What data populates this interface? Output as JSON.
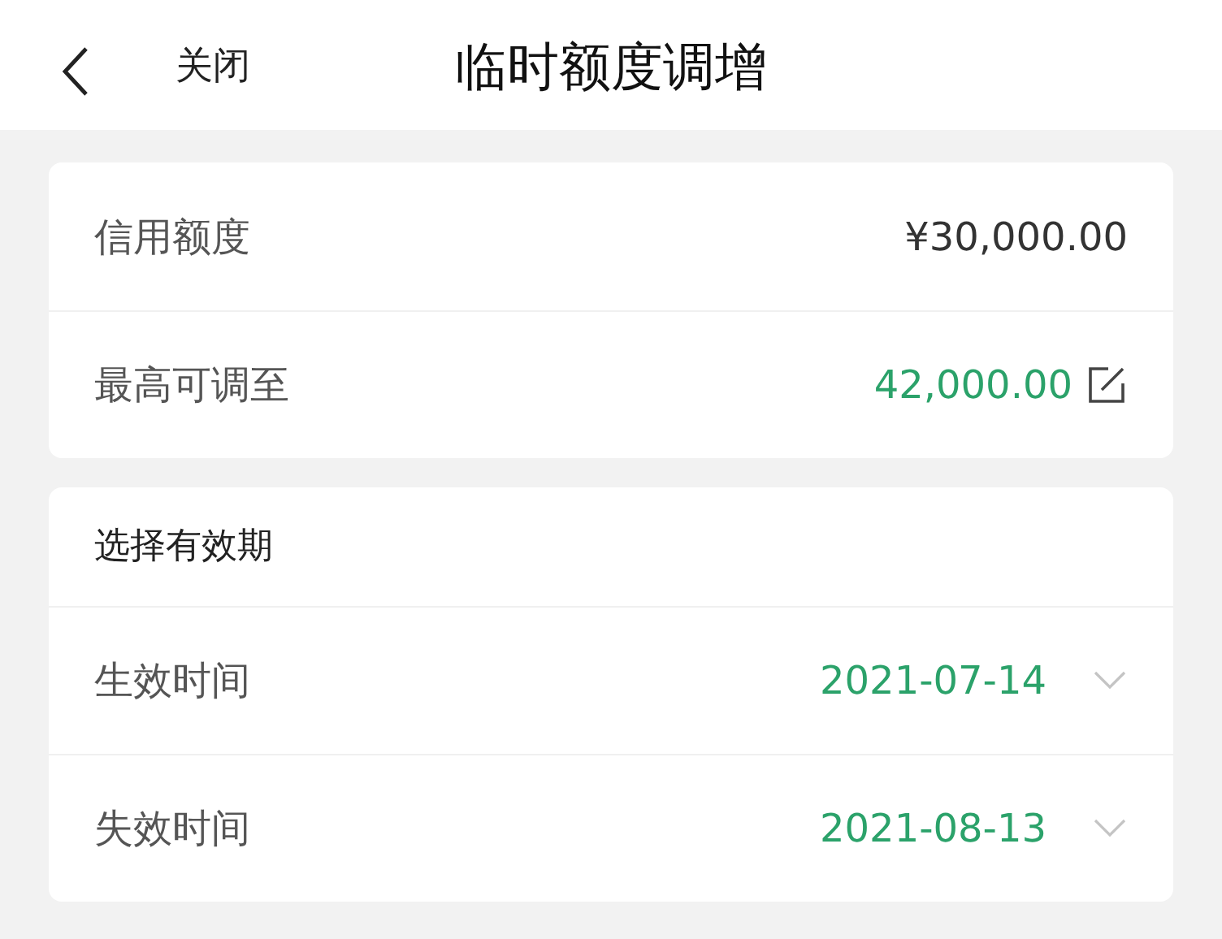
{
  "header": {
    "close_label": "关闭",
    "title": "临时额度调增"
  },
  "limit_card": {
    "rows": [
      {
        "label": "信用额度",
        "value": "¥30,000.00",
        "kind": "plain"
      },
      {
        "label": "最高可调至",
        "value": "42,000.00",
        "kind": "editable"
      }
    ]
  },
  "validity_card": {
    "heading": "选择有效期",
    "rows": [
      {
        "label": "生效时间",
        "value": "2021-07-14",
        "kind": "date"
      },
      {
        "label": "失效时间",
        "value": "2021-08-13",
        "kind": "date"
      }
    ]
  }
}
